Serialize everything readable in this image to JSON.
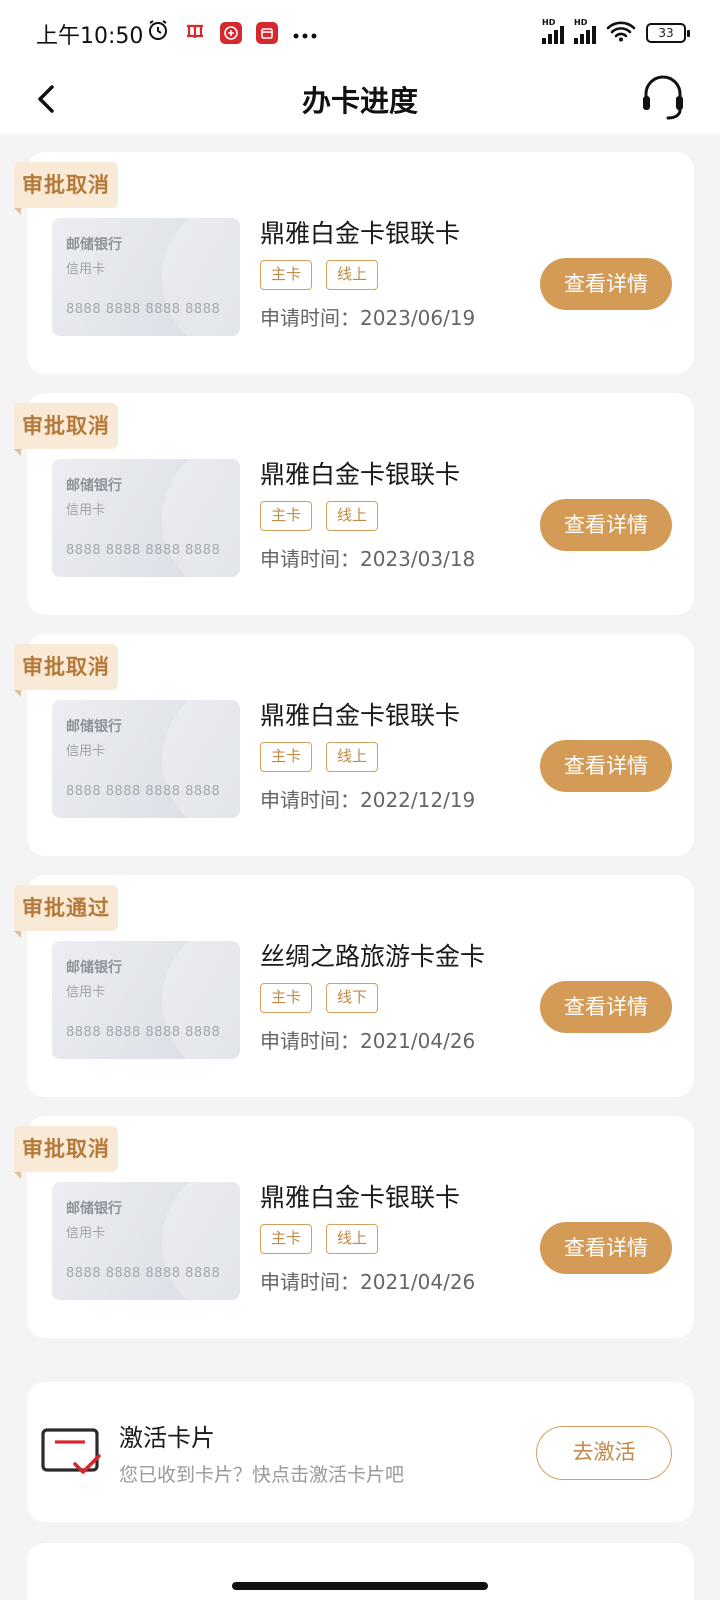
{
  "status_bar": {
    "time": "上午10:50",
    "battery": "33",
    "network_label": "HD",
    "icons": [
      "alarm-icon",
      "postal-app-icon",
      "bank-app-icon",
      "calendar-app-icon",
      "more-icon",
      "signal-icon",
      "wifi-icon",
      "battery-icon"
    ]
  },
  "header": {
    "title": "办卡进度",
    "back_icon": "chevron-left-icon",
    "support_icon": "headset-icon"
  },
  "applications": [
    {
      "status": "审批取消",
      "card_face": {
        "bank": "邮储银行",
        "type": "信用卡",
        "number": "8888 8888 8888 8888"
      },
      "card_name": "鼎雅白金卡银联卡",
      "tags": [
        "主卡",
        "线上"
      ],
      "apply_date": "申请时间：2023/06/19",
      "action": "查看详情"
    },
    {
      "status": "审批取消",
      "card_face": {
        "bank": "邮储银行",
        "type": "信用卡",
        "number": "8888 8888 8888 8888"
      },
      "card_name": "鼎雅白金卡银联卡",
      "tags": [
        "主卡",
        "线上"
      ],
      "apply_date": "申请时间：2023/03/18",
      "action": "查看详情"
    },
    {
      "status": "审批取消",
      "card_face": {
        "bank": "邮储银行",
        "type": "信用卡",
        "number": "8888 8888 8888 8888"
      },
      "card_name": "鼎雅白金卡银联卡",
      "tags": [
        "主卡",
        "线上"
      ],
      "apply_date": "申请时间：2022/12/19",
      "action": "查看详情"
    },
    {
      "status": "审批通过",
      "card_face": {
        "bank": "邮储银行",
        "type": "信用卡",
        "number": "8888 8888 8888 8888"
      },
      "card_name": "丝绸之路旅游卡金卡",
      "tags": [
        "主卡",
        "线下"
      ],
      "apply_date": "申请时间：2021/04/26",
      "action": "查看详情"
    },
    {
      "status": "审批取消",
      "card_face": {
        "bank": "邮储银行",
        "type": "信用卡",
        "number": "8888 8888 8888 8888"
      },
      "card_name": "鼎雅白金卡银联卡",
      "tags": [
        "主卡",
        "线上"
      ],
      "apply_date": "申请时间：2021/04/26",
      "action": "查看详情"
    }
  ],
  "activate": {
    "icon": "card-check-icon",
    "title": "激活卡片",
    "subtitle": "您已收到卡片？快点击激活卡片吧",
    "button": "去激活"
  },
  "colors": {
    "accent": "#d49b57",
    "tag_bg": "#f8ead6",
    "tag_text": "#b57a3a",
    "page_bg": "#f4f4f5",
    "icon_red": "#d5292f"
  }
}
